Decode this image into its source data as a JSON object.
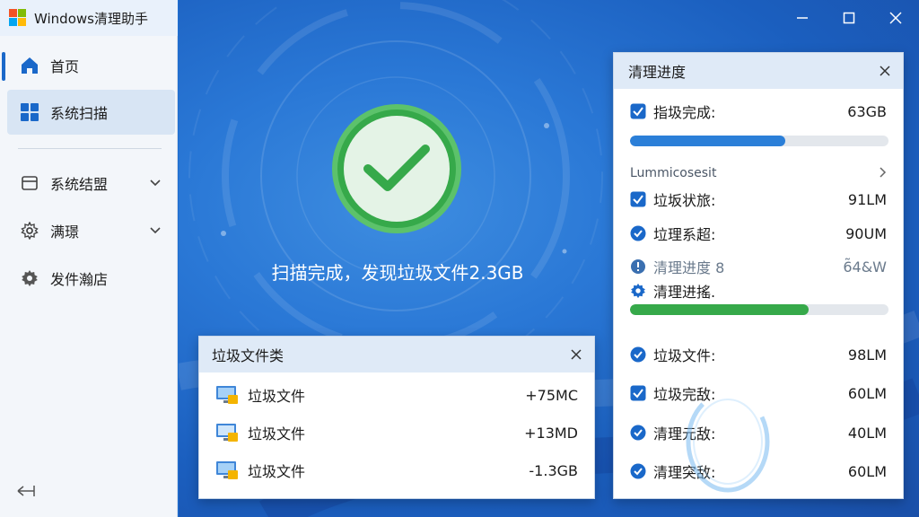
{
  "window": {
    "title": "Windows清理助手",
    "controls": [
      "minimize",
      "maximize",
      "close"
    ]
  },
  "sidebar": {
    "items": [
      {
        "label": "首页",
        "icon": "home-icon",
        "active": false
      },
      {
        "label": "系统扫描",
        "icon": "grid-icon",
        "active": true
      },
      {
        "label": "系统结盟",
        "icon": "folder-icon",
        "active": false
      },
      {
        "label": "满璟",
        "icon": "gear-icon",
        "active": false
      },
      {
        "label": "发件瀚店",
        "icon": "gear-icon",
        "active": false
      }
    ]
  },
  "main": {
    "scan_message": "扫描完成，发现垃圾文件2.3GB",
    "status_icon": "checkmark-icon"
  },
  "junk_panel": {
    "title": "垃圾文件类",
    "rows": [
      {
        "name": "垃圾文件",
        "size": "+75MC"
      },
      {
        "name": "垃圾文件",
        "size": "+13MD"
      },
      {
        "name": "垃圾文件",
        "size": "-1.3GB"
      }
    ]
  },
  "progress_panel": {
    "title": "清理进度",
    "top_row": {
      "label": "指圾完成:",
      "value": "63GB",
      "progress": 0.6
    },
    "sub_heading": "Lummicosesit",
    "rows_a": [
      {
        "label": "垃坂状旅:",
        "value": "91LM"
      },
      {
        "label": "垃理系超:",
        "value": "90UM"
      },
      {
        "label": "清理进度 8",
        "value": "6̃4&W"
      },
      {
        "label": "清理进搖.",
        "value": ""
      }
    ],
    "mid_progress": 0.69,
    "rows_b": [
      {
        "label": "垃圾文件:",
        "value": "98LM"
      },
      {
        "label": "垃圾完敌:",
        "value": "60LM"
      },
      {
        "label": "清理元敌:",
        "value": "40LM"
      },
      {
        "label": "清理突敌:",
        "value": "60LM"
      }
    ]
  },
  "colors": {
    "accent": "#1a68c9",
    "progress_blue": "#2b7fd8",
    "progress_green": "#36a94a",
    "check_green": "#36a94a"
  }
}
